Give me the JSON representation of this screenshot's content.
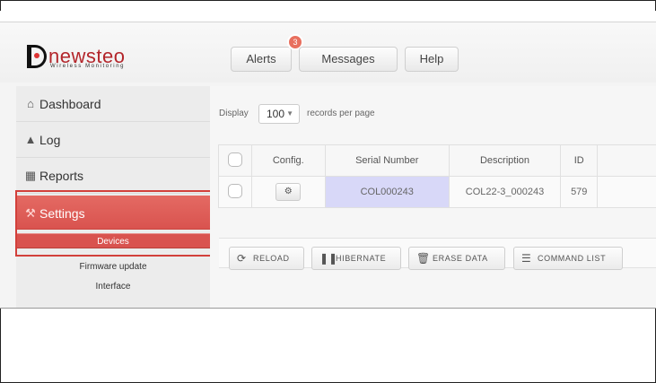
{
  "brand": {
    "name": "newsteo",
    "tagline": "Wireless Monitoring"
  },
  "header": {
    "alerts_label": "Alerts",
    "alerts_badge": "3",
    "messages_label": "Messages",
    "help_label": "Help"
  },
  "sidebar": {
    "items": [
      {
        "label": "Dashboard",
        "icon": "home-icon"
      },
      {
        "label": "Log",
        "icon": "pin-icon"
      },
      {
        "label": "Reports",
        "icon": "report-icon"
      },
      {
        "label": "Settings",
        "icon": "wrench-icon"
      }
    ],
    "subitems": [
      {
        "label": "Devices"
      },
      {
        "label": "Firmware update"
      },
      {
        "label": "Interface"
      }
    ]
  },
  "table_controls": {
    "display_label": "Display",
    "page_size": "100",
    "records_label": "records per page"
  },
  "table": {
    "columns": [
      "",
      "Config.",
      "Serial Number",
      "Description",
      "ID"
    ],
    "rows": [
      {
        "serial": "COL000243",
        "description": "COL22-3_000243",
        "id": "579"
      }
    ]
  },
  "actions": {
    "reload": "RELOAD",
    "hibernate": "HIBERNATE",
    "erase": "ERASE DATA",
    "command_list": "COMMAND LIST"
  },
  "colors": {
    "accent": "#d9534f",
    "selected_cell": "#d8d8f8",
    "brand": "#b3262b"
  }
}
